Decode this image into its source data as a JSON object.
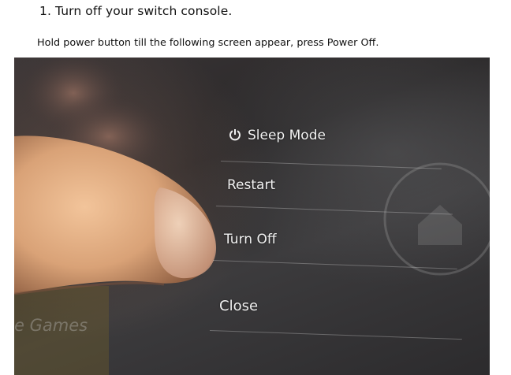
{
  "step": {
    "title": "1. Turn off your switch console."
  },
  "instruction": {
    "text": "Hold power button till the following screen appear, press Power Off."
  },
  "photo": {
    "menu": {
      "sleep_mode": "Sleep Mode",
      "restart": "Restart",
      "turn_off": "Turn Off",
      "close": "Close"
    },
    "background_text": "e Games"
  },
  "icons": {
    "sleep_mode": "power-icon",
    "background": "home-icon"
  }
}
